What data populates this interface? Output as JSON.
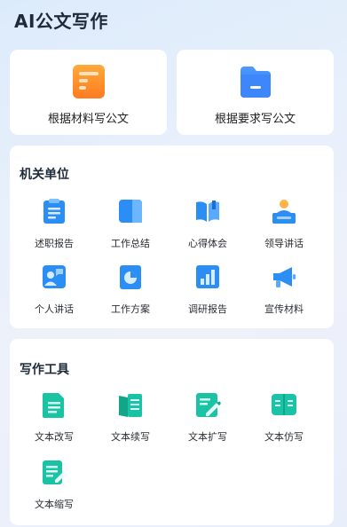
{
  "app": {
    "title": "AI公文写作"
  },
  "features": [
    {
      "label": "根据材料写公文",
      "icon": "document-orange-icon",
      "color": "#ff8a2b"
    },
    {
      "label": "根据要求写公文",
      "icon": "folder-blue-icon",
      "color": "#2f7dff"
    }
  ],
  "org": {
    "title": "机关单位",
    "items": [
      {
        "label": "述职报告",
        "icon": "clipboard-icon"
      },
      {
        "label": "工作总结",
        "icon": "summary-icon"
      },
      {
        "label": "心得体会",
        "icon": "book-open-icon"
      },
      {
        "label": "领导讲话",
        "icon": "podium-icon"
      },
      {
        "label": "个人讲话",
        "icon": "person-speech-icon"
      },
      {
        "label": "工作方案",
        "icon": "pie-chart-doc-icon"
      },
      {
        "label": "调研报告",
        "icon": "bar-chart-icon"
      },
      {
        "label": "宣传材料",
        "icon": "megaphone-icon"
      }
    ]
  },
  "tools": {
    "title": "写作工具",
    "items": [
      {
        "label": "文本改写",
        "icon": "text-rewrite-icon"
      },
      {
        "label": "文本续写",
        "icon": "text-continue-icon"
      },
      {
        "label": "文本扩写",
        "icon": "text-expand-icon"
      },
      {
        "label": "文本仿写",
        "icon": "text-imitate-icon"
      },
      {
        "label": "文本缩写",
        "icon": "text-abbreviate-icon"
      }
    ]
  },
  "colors": {
    "blue": "#2b8ef5",
    "teal": "#19c3a4",
    "orange": "#ff8a2b"
  }
}
